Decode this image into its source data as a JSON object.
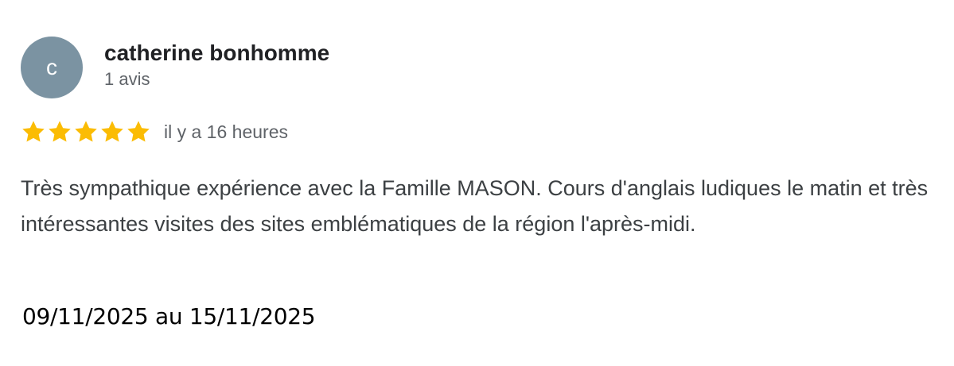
{
  "review": {
    "avatar_initial": "c",
    "avatar_color": "#7b93a2",
    "author_name": "catherine bonhomme",
    "review_count": "1 avis",
    "rating": 5,
    "rating_max": 5,
    "star_color": "#fbbc04",
    "time_ago": "il y a 16 heures",
    "text": "Très sympathique expérience avec la Famille MASON. Cours d'anglais ludiques le matin et très intéressantes visites des sites emblématiques de la région l'après-midi.",
    "date_range": "09/11/2025 au 15/11/2025"
  }
}
